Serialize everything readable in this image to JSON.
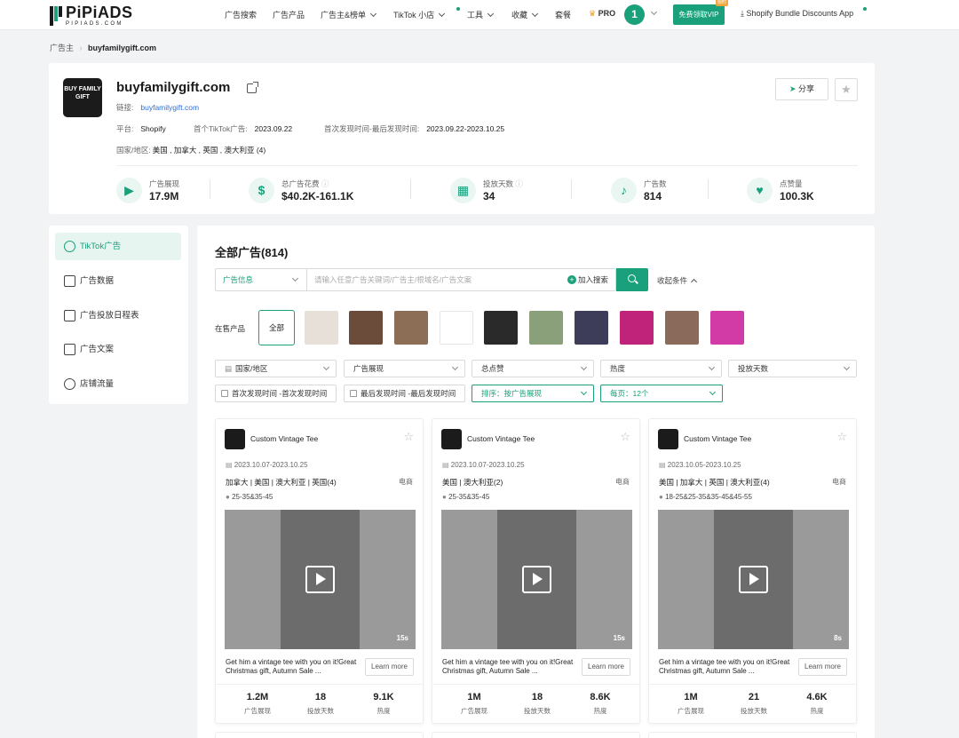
{
  "nav": {
    "logo_title": "PiPiADS",
    "logo_sub": "PIPIADS.COM",
    "items": [
      "广告搜索",
      "广告产品",
      "广告主&榜单",
      "TikTok 小店",
      "工具",
      "收藏",
      "套餐"
    ],
    "pro_label": "PRO",
    "avatar_number": "1",
    "vip_label": "免费领取VIP",
    "vip_flag": "限时",
    "shopify_label": "Shopify Bundle Discounts App"
  },
  "breadcrumb": {
    "parent": "广告主",
    "current": "buyfamilygift.com"
  },
  "advertiser": {
    "logo_text": "BUY FAMILY GIFT",
    "name": "buyfamilygift.com",
    "link_label": "链接:",
    "link": "buyfamilygift.com",
    "platform_label": "平台:",
    "platform": "Shopify",
    "first_ad_label": "首个TikTok广告:",
    "first_ad": "2023.09.22",
    "range_label": "首次发现时间-最后发现时间:",
    "range": "2023.09.22-2023.10.25",
    "region_label": "国家/地区:",
    "regions": "美国 , 加拿大 , 英国 , 澳大利亚 (4)",
    "share_label": "分享"
  },
  "stats": [
    {
      "label": "广告展现",
      "value": "17.9M"
    },
    {
      "label": "总广告花费",
      "value": "$40.2K-161.1K"
    },
    {
      "label": "投放天数",
      "value": "34"
    },
    {
      "label": "广告数",
      "value": "814"
    },
    {
      "label": "点赞量",
      "value": "100.3K"
    }
  ],
  "sidebar": {
    "items": [
      {
        "label": "TikTok广告",
        "active": true
      },
      {
        "label": "广告数据"
      },
      {
        "label": "广告投放日程表"
      },
      {
        "label": "广告文案"
      },
      {
        "label": "店铺流量"
      }
    ]
  },
  "main": {
    "title": "全部广告(814)",
    "search_select": "广告信息",
    "search_placeholder": "请输入任意广告关键词/广告主/根域名/广告文案",
    "add_search": "加入搜索",
    "collapse": "收起条件",
    "products_label": "在售产品",
    "all_label": "全部",
    "thumb_colors": [
      "#e6e0d9",
      "#6b4b3a",
      "#8c6e57",
      "#ffffff",
      "#2a2a2a",
      "#8aa07a",
      "#3d3d5a",
      "#c0247a",
      "#8a6a5a",
      "#d23aa6"
    ],
    "filters": [
      "国家/地区",
      "广告展现",
      "总点赞",
      "热度",
      "投放天数"
    ],
    "filters2": [
      "首次发现时间 -首次发现时间",
      "最后发现时间 -最后发现时间"
    ],
    "sort": "排序：按广告展现",
    "per_page": "每页：12个"
  },
  "ads": [
    {
      "name": "Custom Vintage Tee",
      "date": "2023.10.07-2023.10.25",
      "region": "加拿大 | 美国 | 澳大利亚 | 英国(4)",
      "type": "电商",
      "age": "25-35&35-45",
      "duration": "15s",
      "desc": "Get him a vintage tee with you on it!Great Christmas gift, Autumn Sale ...",
      "more": "Learn more",
      "impressions": "1.2M",
      "days": "18",
      "heat": "9.1K",
      "l1": "广告展现",
      "l2": "投放天数",
      "l3": "热度"
    },
    {
      "name": "Custom Vintage Tee",
      "date": "2023.10.07-2023.10.25",
      "region": "美国 | 澳大利亚(2)",
      "type": "电商",
      "age": "25-35&35-45",
      "duration": "15s",
      "desc": "Get him a vintage tee with you on it!Great Christmas gift, Autumn Sale ...",
      "more": "Learn more",
      "impressions": "1M",
      "days": "18",
      "heat": "8.6K",
      "l1": "广告展现",
      "l2": "投放天数",
      "l3": "热度"
    },
    {
      "name": "Custom Vintage Tee",
      "date": "2023.10.05-2023.10.25",
      "region": "美国 | 加拿大 | 英国 | 澳大利亚(4)",
      "type": "电商",
      "age": "18-25&25-35&35-45&45-55",
      "duration": "8s",
      "desc": "Get him a vintage tee with you on it!Great Christmas gift, Autumn Sale ...",
      "more": "Learn more",
      "impressions": "1M",
      "days": "21",
      "heat": "4.6K",
      "l1": "广告展现",
      "l2": "投放天数",
      "l3": "热度"
    }
  ]
}
